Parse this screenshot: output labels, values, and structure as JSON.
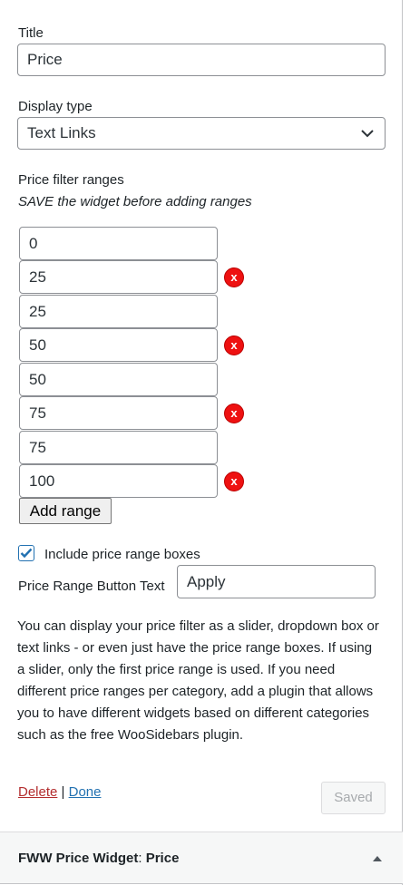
{
  "form": {
    "title_label": "Title",
    "title_value": "Price",
    "display_type_label": "Display type",
    "display_type_value": "Text Links",
    "ranges_label": "Price filter ranges",
    "ranges_note": "SAVE the widget before adding ranges",
    "ranges": [
      "0",
      "25",
      "25",
      "50",
      "50",
      "75",
      "75",
      "100"
    ],
    "remove_label": "x",
    "add_range_label": "Add range",
    "include_boxes_label": "Include price range boxes",
    "include_boxes_checked": true,
    "button_text_label": "Price Range Button Text",
    "button_text_value": "Apply",
    "description": "You can display your price filter as a slider, dropdown box or text links - or even just have the price range boxes. If using a slider, only the first price range is used. If you need different price ranges per category, add a plugin that allows you to have different widgets based on different categories such as the free WooSidebars plugin.",
    "delete_label": "Delete",
    "separator": "|",
    "done_label": "Done",
    "saved_label": "Saved"
  },
  "footer": {
    "widget_name": "FWW Price Widget",
    "widget_title_sep": ":",
    "widget_title": "Price"
  },
  "colors": {
    "accent": "#2271b1",
    "delete": "#b32d2e",
    "remove": "#ee1111"
  }
}
